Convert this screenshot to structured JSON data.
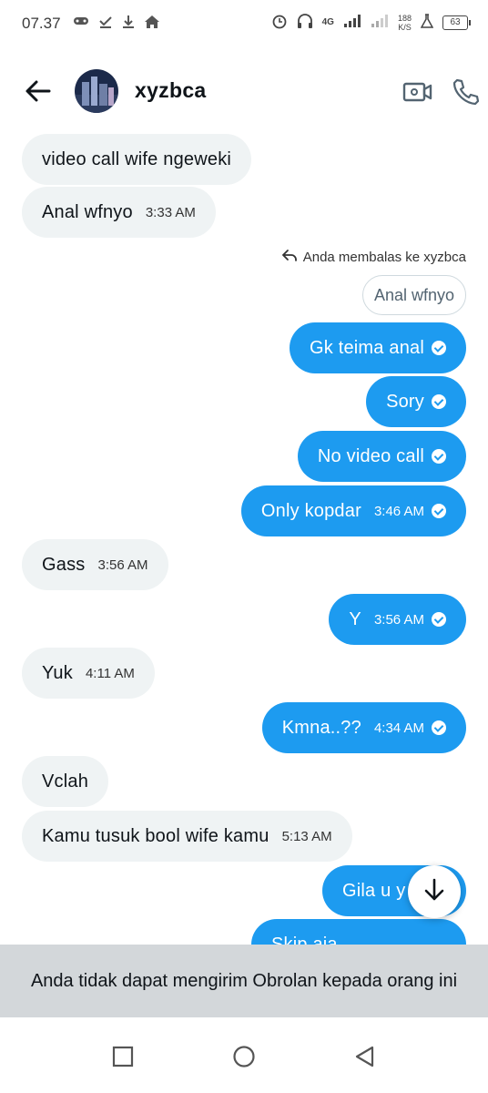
{
  "status_bar": {
    "time": "07.37",
    "network": "4G",
    "speed": "188",
    "speed_unit": "K/S",
    "battery": "63"
  },
  "header": {
    "contact_name": "xyzbca",
    "icons": [
      "back-arrow-icon",
      "video-call-icon",
      "phone-icon"
    ]
  },
  "reply": {
    "info": "Anda membalas ke xyzbca",
    "quoted": "Anal wfnyo"
  },
  "messages": [
    {
      "dir": "in",
      "text": "video call wife ngeweki",
      "time": ""
    },
    {
      "dir": "in",
      "text": "Anal wfnyo",
      "time": "3:33 AM"
    },
    {
      "dir": "out",
      "text": "Gk teima anal",
      "time": ""
    },
    {
      "dir": "out",
      "text": "Sory",
      "time": ""
    },
    {
      "dir": "out",
      "text": "No video call",
      "time": ""
    },
    {
      "dir": "out",
      "text": "Only kopdar",
      "time": "3:46 AM"
    },
    {
      "dir": "in",
      "text": "Gass",
      "time": "3:56 AM"
    },
    {
      "dir": "out",
      "text": "Y",
      "time": "3:56 AM"
    },
    {
      "dir": "in",
      "text": "Yuk",
      "time": "4:11 AM"
    },
    {
      "dir": "out",
      "text": "Kmna..??",
      "time": "4:34 AM"
    },
    {
      "dir": "in",
      "text": "Vclah",
      "time": ""
    },
    {
      "dir": "in",
      "text": "Kamu tusuk bool wife kamu",
      "time": "5:13 AM"
    },
    {
      "dir": "out",
      "text": "Gila u y",
      "time": ""
    },
    {
      "dir": "out",
      "text": "Skip aja",
      "time": ""
    }
  ],
  "notice": "Anda tidak dapat mengirim Obrolan kepada orang ini",
  "colors": {
    "outgoing": "#1d9bf0",
    "incoming": "#eff3f4",
    "notice_bg": "#d3d7da"
  }
}
